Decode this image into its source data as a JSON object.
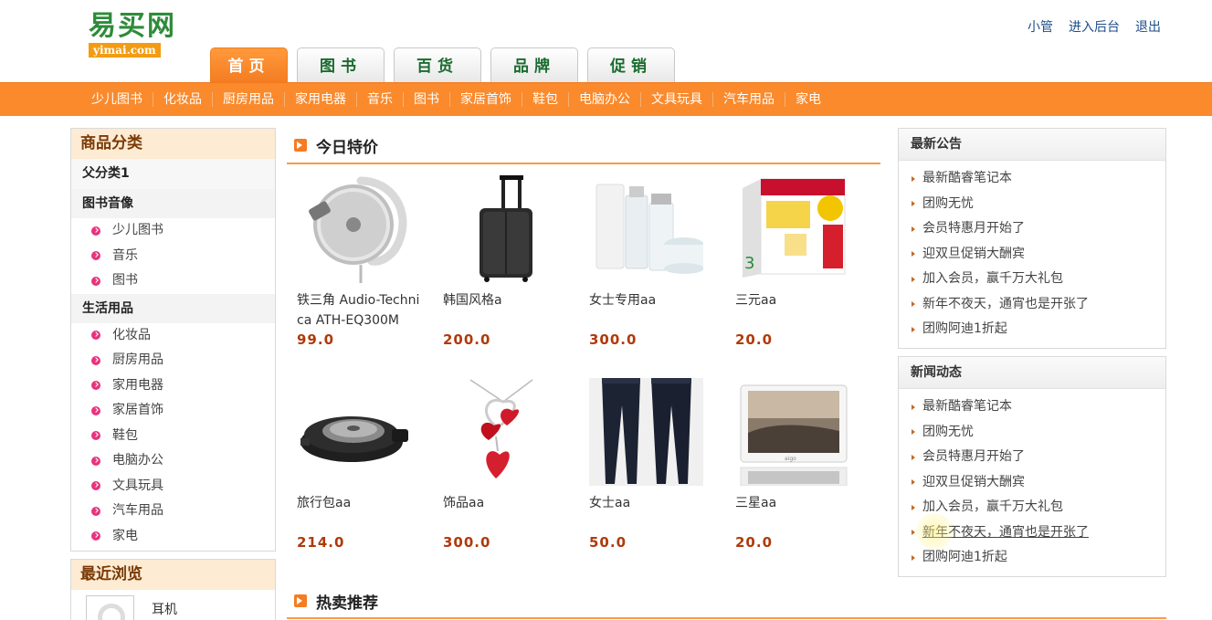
{
  "logo": {
    "cn": "易买网",
    "en": "yimai.com"
  },
  "toplinks": [
    "小管",
    "进入后台",
    "退出"
  ],
  "tabs": [
    "首页",
    "图书",
    "百货",
    "品牌",
    "促销"
  ],
  "navbar": [
    "少儿图书",
    "化妆品",
    "厨房用品",
    "家用电器",
    "音乐",
    "图书",
    "家居首饰",
    "鞋包",
    "电脑办公",
    "文具玩具",
    "汽车用品",
    "家电"
  ],
  "colors": {
    "accent": "#fa8a2c",
    "price": "#b03a0a",
    "logo_green": "#2e8b3a",
    "bullet": "#e8337d"
  },
  "sidebar": {
    "title": "商品分类",
    "parent": "父分类1",
    "groups": [
      {
        "name": "图书音像",
        "items": [
          "少儿图书",
          "音乐",
          "图书"
        ]
      },
      {
        "name": "生活用品",
        "items": [
          "化妆品",
          "厨房用品",
          "家用电器",
          "家居首饰",
          "鞋包",
          "电脑办公",
          "文具玩具",
          "汽车用品",
          "家电"
        ]
      }
    ]
  },
  "recent": {
    "title": "最近浏览",
    "items": [
      {
        "name": "耳机",
        "icon": "headphone-thumb"
      }
    ]
  },
  "today": {
    "title": "今日特价",
    "products": [
      {
        "name": "铁三角 Audio-Technica ATH-EQ300M",
        "price": "99.0",
        "icon": "headphone"
      },
      {
        "name": "韩国风格a",
        "price": "200.0",
        "icon": "suitcase"
      },
      {
        "name": "女士专用aa",
        "price": "300.0",
        "icon": "cosmetics"
      },
      {
        "name": "三元aa",
        "price": "20.0",
        "icon": "milk-box"
      },
      {
        "name": "旅行包aa",
        "price": "214.0",
        "icon": "grill"
      },
      {
        "name": "饰品aa",
        "price": "300.0",
        "icon": "heart-pendant"
      },
      {
        "name": "女士aa",
        "price": "50.0",
        "icon": "jeans"
      },
      {
        "name": "三星aa",
        "price": "20.0",
        "icon": "photo-frame"
      }
    ]
  },
  "hot": {
    "title": "热卖推荐"
  },
  "notices": {
    "title": "最新公告",
    "items": [
      "最新酷睿笔记本",
      "团购无忧",
      "会员特惠月开始了",
      "迎双旦促销大酬宾",
      "加入会员，赢千万大礼包",
      "新年不夜天，通宵也是开张了",
      "团购阿迪1折起"
    ]
  },
  "news": {
    "title": "新闻动态",
    "items": [
      "最新酷睿笔记本",
      "团购无忧",
      "会员特惠月开始了",
      "迎双旦促销大酬宾",
      "加入会员，赢千万大礼包",
      "新年不夜天，通宵也是开张了",
      "团购阿迪1折起"
    ],
    "hovered_index": 5
  }
}
